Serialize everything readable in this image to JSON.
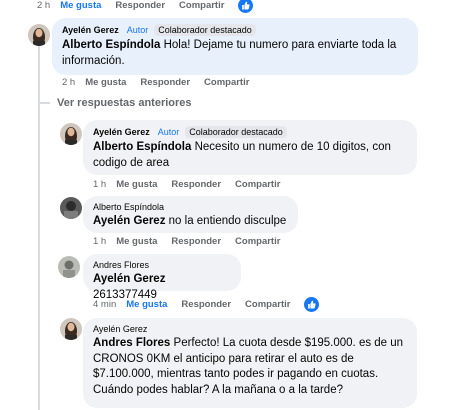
{
  "top_actions": {
    "time": "2 h",
    "like": "Me gusta",
    "reply": "Responder",
    "share": "Compartir"
  },
  "comment1": {
    "author": "Ayelén Gerez",
    "role": "Autor",
    "badge": "Colaborador destacado",
    "mention": "Alberto Espíndola",
    "text_line1": " Hola! Dejame tu numero para enviarte toda la",
    "text_line2": "información.",
    "actions": {
      "time": "2 h",
      "like": "Me gusta",
      "reply": "Responder",
      "share": "Compartir"
    }
  },
  "view_previous": "Ver respuestas anteriores",
  "reply1": {
    "author": "Ayelén Gerez",
    "role": "Autor",
    "badge": "Colaborador destacado",
    "mention": "Alberto Espíndola",
    "text_line1": " Necesito un numero de 10 digitos, con",
    "text_line2": "codigo de area",
    "actions": {
      "time": "1 h",
      "like": "Me gusta",
      "reply": "Responder",
      "share": "Compartir"
    }
  },
  "reply2": {
    "author": "Alberto Espíndola",
    "mention": "Ayelén Gerez",
    "text_line1": " no la entiendo disculpe",
    "actions": {
      "time": "1 h",
      "like": "Me gusta",
      "reply": "Responder",
      "share": "Compartir"
    }
  },
  "reply3": {
    "author": "Andres Flores",
    "mention": "Ayelén Gerez",
    "text_line1": " 2613377449",
    "actions": {
      "time": "4 min",
      "like": "Me gusta",
      "reply": "Responder",
      "share": "Compartir"
    }
  },
  "reply4": {
    "author": "Ayelén Gerez",
    "mention": "Andres Flores",
    "text_line1": " Perfecto! La cuota desde $195.000. es de un",
    "text_line2": "CRONOS 0KM el anticipo para retirar el auto es de",
    "text_line3": "$7.100.000, mientras tanto podes ir pagando en cuotas.",
    "text_line4": "Cuándo podes hablar? A la mañana o a la tarde?"
  },
  "colors": {
    "link": "#1877f2",
    "bubble": "#f0f2f5",
    "highlight": "#e7f0fb",
    "meta": "#65676b"
  }
}
